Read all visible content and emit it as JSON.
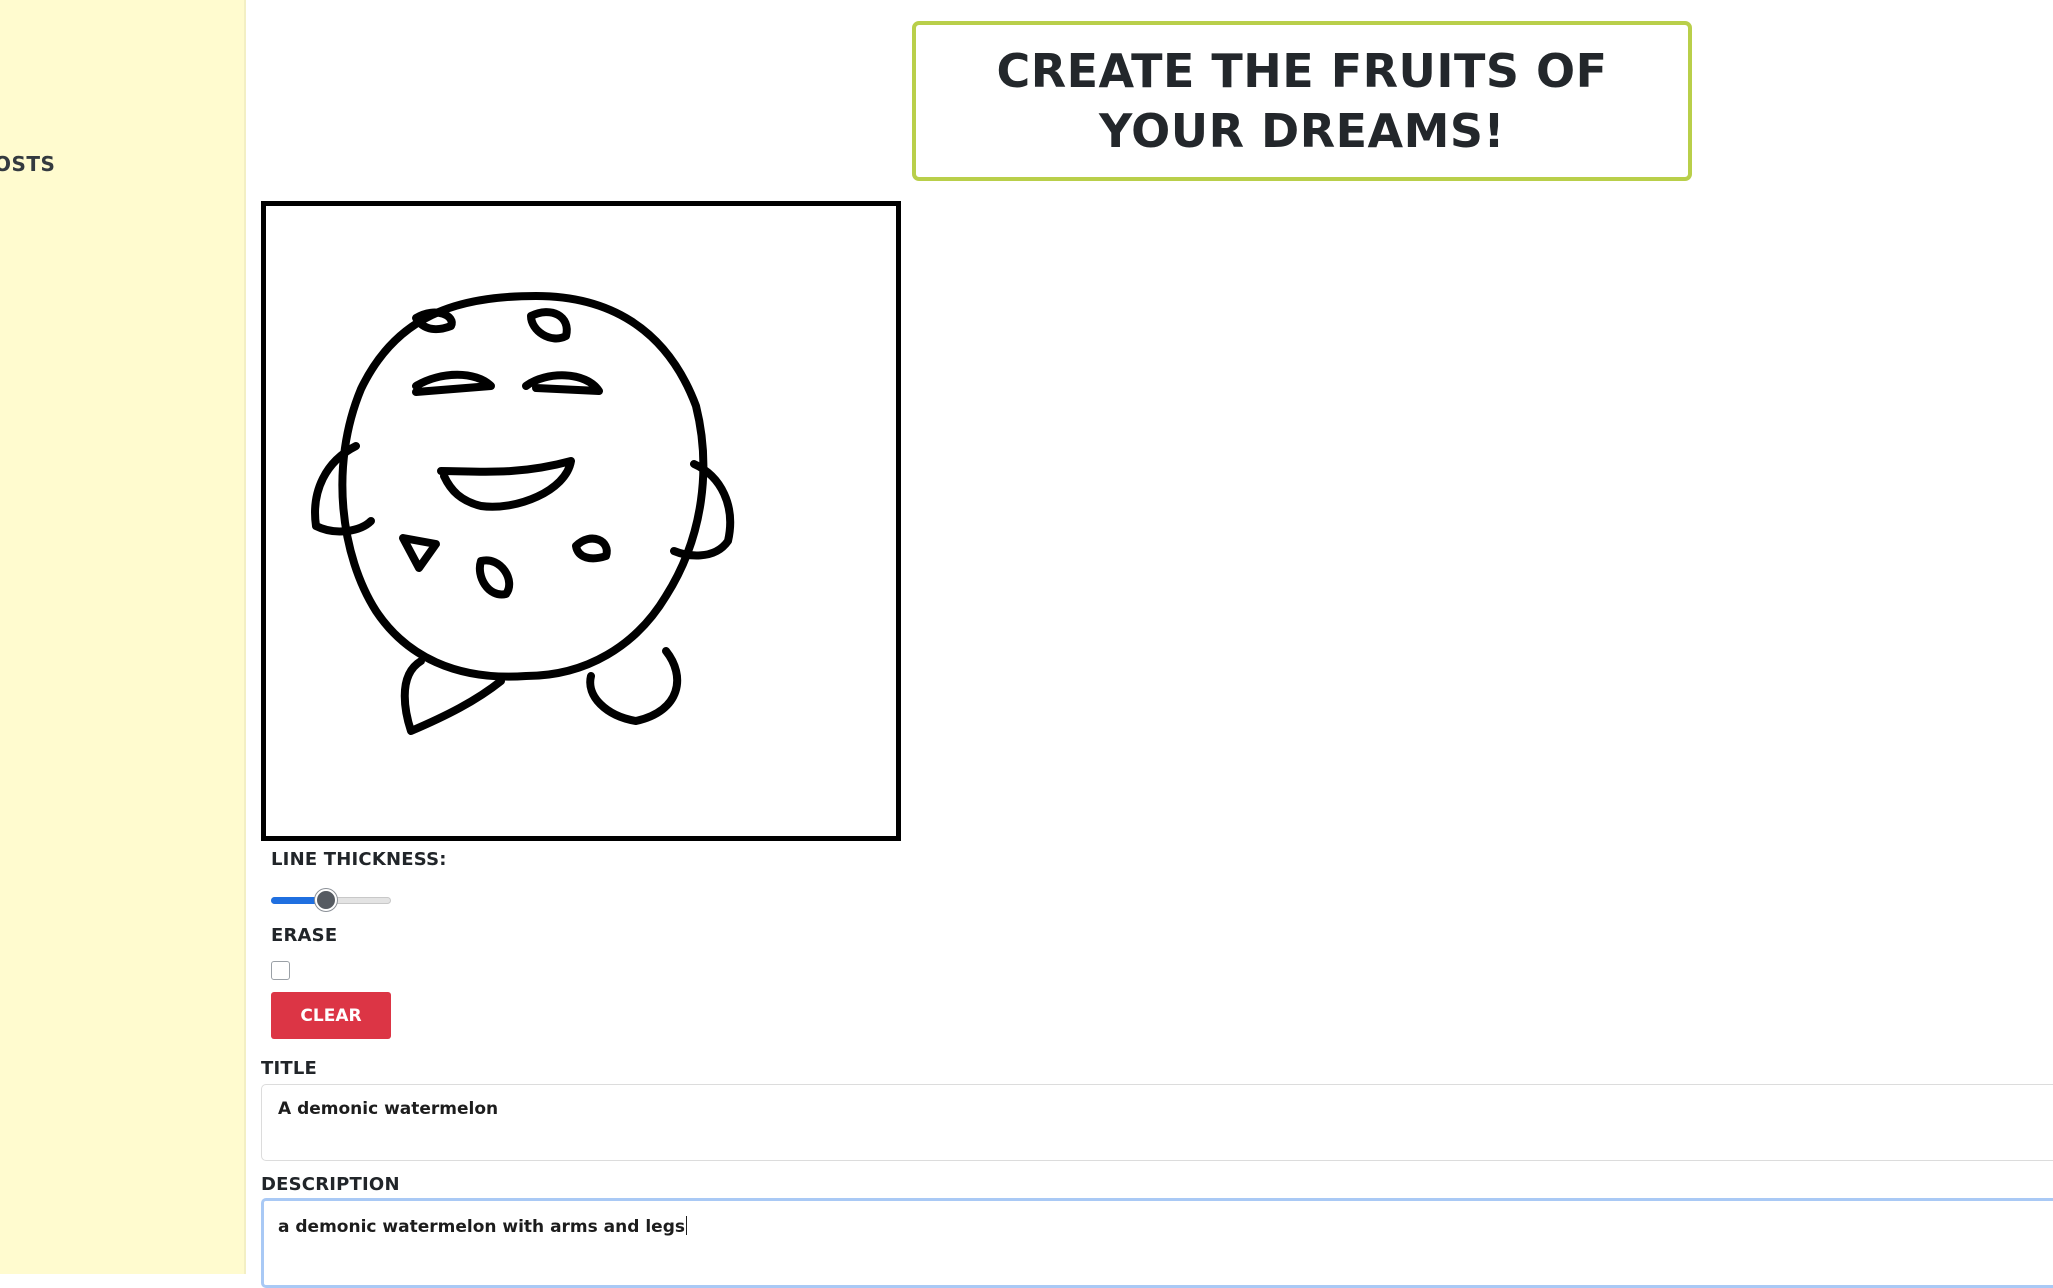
{
  "sidebar": {
    "items": [
      {
        "label": "OSTS"
      }
    ]
  },
  "header": {
    "title": "CREATE THE FRUITS OF YOUR DREAMS!"
  },
  "controls": {
    "line_thickness_label": "LINE THICKNESS:",
    "line_thickness_fraction": 0.46,
    "erase_label": "ERASE",
    "erase_checked": false,
    "clear_label": "CLEAR"
  },
  "form": {
    "title_label": "TITLE",
    "title_value": "A demonic watermelon",
    "description_label": "DESCRIPTION",
    "description_value": "a demonic watermelon with arms and legs"
  },
  "colors": {
    "sidebar_bg": "#fffbcf",
    "header_border": "#b9cf4a",
    "clear_button": "#dc3545",
    "slider_fill": "#1f6fe0",
    "focus_border": "#a9c9f5"
  }
}
